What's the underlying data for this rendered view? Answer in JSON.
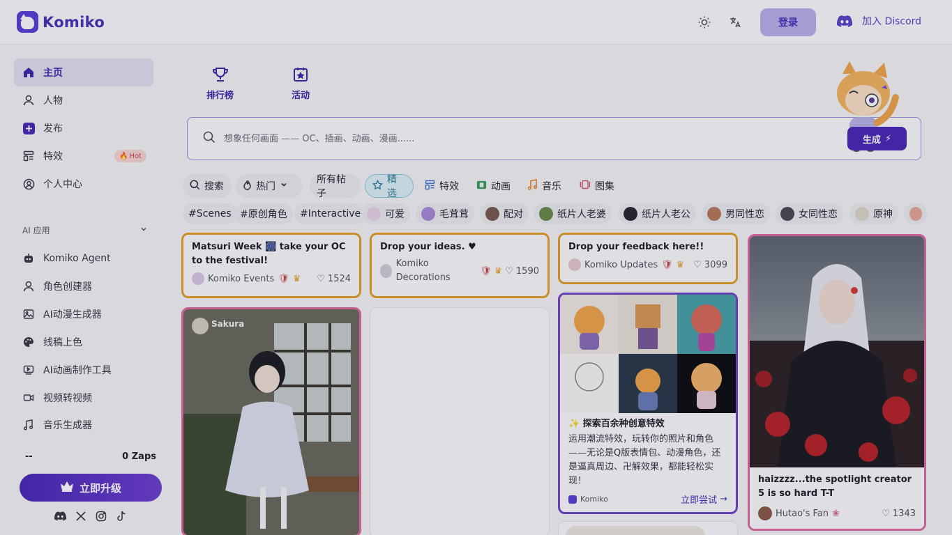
{
  "brand": {
    "name": "Komiko",
    "accent": "#4a33b8"
  },
  "header": {
    "theme_icon": "sun-icon",
    "lang_icon": "translate-icon",
    "login_label": "登录",
    "discord_label": "加入 Discord"
  },
  "sidebar": {
    "items": [
      {
        "label": "主页",
        "icon": "home-icon"
      },
      {
        "label": "人物",
        "icon": "user-icon"
      },
      {
        "label": "发布",
        "icon": "plus-icon"
      },
      {
        "label": "特效",
        "icon": "effects-icon",
        "badge": "Hot"
      },
      {
        "label": "个人中心",
        "icon": "profile-icon"
      }
    ],
    "section_title": "AI 应用",
    "tools": [
      {
        "label": "Komiko Agent",
        "icon": "robot-icon"
      },
      {
        "label": "角色创建器",
        "icon": "user-icon"
      },
      {
        "label": "AI动漫生成器",
        "icon": "image-icon"
      },
      {
        "label": "线稿上色",
        "icon": "palette-icon"
      },
      {
        "label": "AI动画制作工具",
        "icon": "video-icon"
      },
      {
        "label": "视频转视频",
        "icon": "camera-icon"
      },
      {
        "label": "音乐生成器",
        "icon": "music-icon"
      }
    ],
    "zaps_left": "--",
    "zaps_right": "0 Zaps",
    "upgrade_label": "立即升级"
  },
  "top_tabs": [
    {
      "label": "排行榜",
      "icon": "trophy-icon"
    },
    {
      "label": "活动",
      "icon": "calendar-star-icon"
    }
  ],
  "prompt": {
    "placeholder": "想象任何画面 —— OC、插画、动画、漫画......",
    "generate_label": "生成"
  },
  "filters": [
    {
      "label": "搜索",
      "icon": "search-icon"
    },
    {
      "label": "热门",
      "icon": "flame-icon"
    },
    {
      "label": "所有帖子"
    },
    {
      "label": "精选",
      "icon": "star-icon"
    },
    {
      "label": "特效",
      "icon": "effects-icon"
    },
    {
      "label": "动画",
      "icon": "film-icon"
    },
    {
      "label": "音乐",
      "icon": "music-icon"
    },
    {
      "label": "图集",
      "icon": "gallery-icon"
    }
  ],
  "tags": [
    "#Scenes",
    "#原创角色",
    "#Interactive",
    "可爱",
    "毛茸茸",
    "配对",
    "纸片人老婆",
    "纸片人老公",
    "男同性恋",
    "女同性恋",
    "原神"
  ],
  "cards": {
    "c1": {
      "title": "Matsuri Week 🎆 take your OC to the festival!",
      "author": "Komiko Events",
      "likes": "1524"
    },
    "c2": {
      "title": "Drop your ideas. ♥",
      "author": "Komiko Decorations",
      "likes": "1590"
    },
    "c3": {
      "title": "Drop your feedback here!!",
      "author": "Komiko Updates",
      "likes": "3099"
    },
    "c4": {
      "title": "haizzzz...the spotlight creator 5 is so hard T-T",
      "author": "Hutao's Fan",
      "likes": "1343"
    },
    "c5": {
      "author": "Sakura"
    },
    "c6": {
      "title": "✨ 探索百余种创意特效",
      "body": "运用潮流特效，玩转你的照片和角色——无论是Q版表情包、动漫角色，还是逼真周边、卍解效果，都能轻松实现！",
      "author": "Komiko",
      "cta": "立即尝试"
    }
  }
}
